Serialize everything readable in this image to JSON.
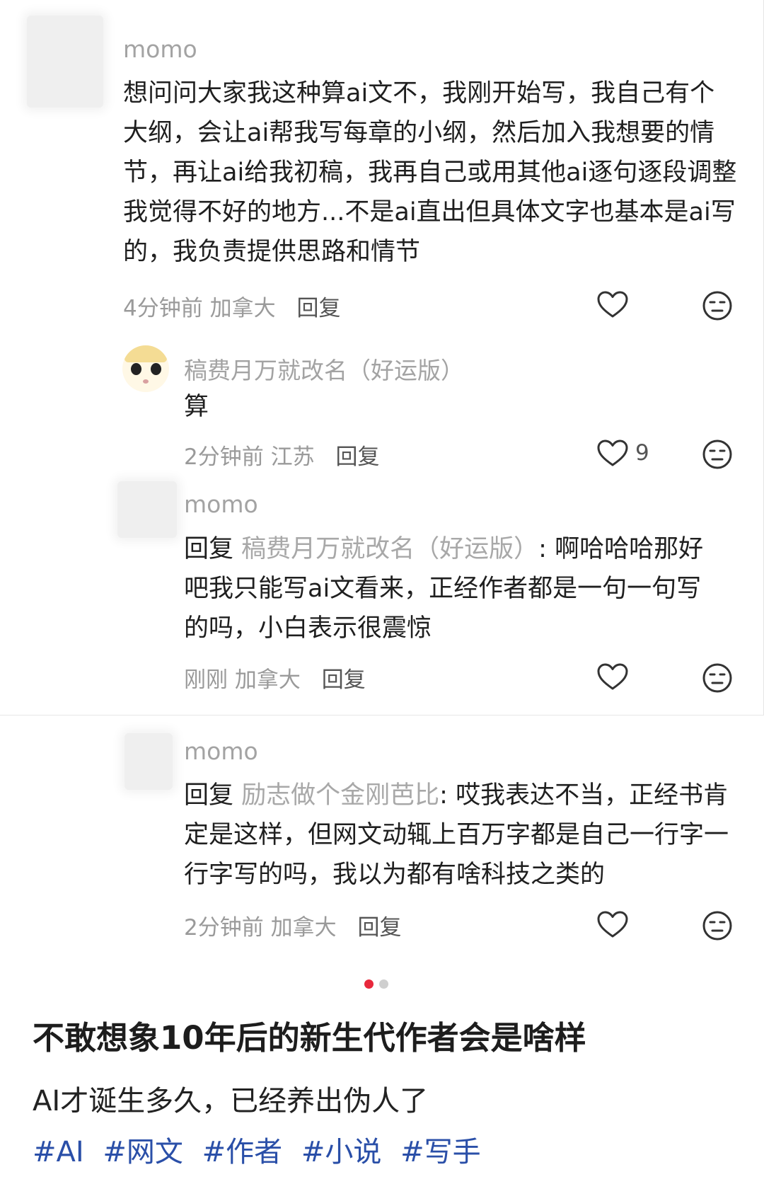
{
  "comments": [
    {
      "name": "momo",
      "text": "想问问大家我这种算ai文不，我刚开始写，我自己有个大纲，会让ai帮我写每章的小纲，然后加入我想要的情节，再让ai给我初稿，我再自己或用其他ai逐句逐段调整我觉得不好的地方...不是ai直出但具体文字也基本是ai写的，我负责提供思路和情节",
      "time": "4分钟前",
      "location": "加拿大",
      "reply_label": "回复"
    },
    {
      "name": "稿费月万就改名（好运版）",
      "text": "算",
      "time": "2分钟前",
      "location": "江苏",
      "reply_label": "回复",
      "likes": "9"
    },
    {
      "name": "momo",
      "reply_prefix": "回复",
      "reply_to": "稿费月万就改名（好运版）",
      "text": ": 啊哈哈哈那好吧我只能写ai文看来，正经作者都是一句一句写的吗，小白表示很震惊",
      "time": "刚刚",
      "location": "加拿大",
      "reply_label": "回复"
    },
    {
      "name": "momo",
      "reply_prefix": "回复",
      "reply_to": "励志做个金刚芭比",
      "text": ": 哎我表达不当，正经书肯定是这样，但网文动辄上百万字都是自己一行字一行字写的吗，我以为都有啥科技之类的",
      "time": "2分钟前",
      "location": "加拿大",
      "reply_label": "回复"
    }
  ],
  "post": {
    "title": "不敢想象10年后的新生代作者会是啥样",
    "description": "AI才诞生多久，已经养出伪人了",
    "tags": [
      "#AI",
      "#网文",
      "#作者",
      "#小说",
      "#写手"
    ]
  },
  "pager": {
    "active_color": "#e8283c",
    "inactive_color": "#cfcfcf"
  },
  "colors": {
    "tag": "#2a4fa8",
    "muted": "#a3a3a3"
  }
}
